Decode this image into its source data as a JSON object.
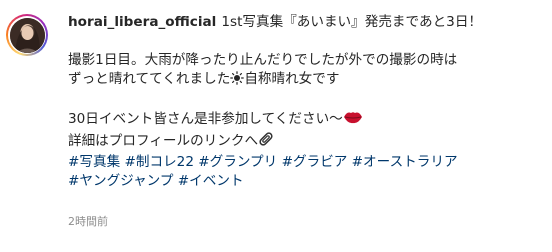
{
  "post": {
    "username": "horai_libera_official",
    "headline": "1st写真集『あいまい』発売まであと3日！",
    "body_line1": "撮影1日目。大雨が降ったり止んだりでしたが外での撮影の時は",
    "body_line2_a": "ずっと晴れててくれました",
    "body_line2_b": "自称晴れ女です",
    "body_line3": "30日イベント皆さん是非参加してください〜",
    "body_line4": "詳細はプロフィールのリンクへ",
    "hashtags": [
      "#写真集",
      "#制コレ22",
      "#グランプリ",
      "#グラビア",
      "#オーストラリア",
      "#ヤングジャンプ",
      "#イベント"
    ],
    "timestamp": "2時間前"
  },
  "colors": {
    "text": "#262626",
    "hashtag": "#00376b",
    "timestamp": "#8e8e8e",
    "lips": "#c8102e"
  },
  "icons": {
    "sun": "sun-icon",
    "lips": "lips-icon",
    "paperclip": "paperclip-icon"
  }
}
